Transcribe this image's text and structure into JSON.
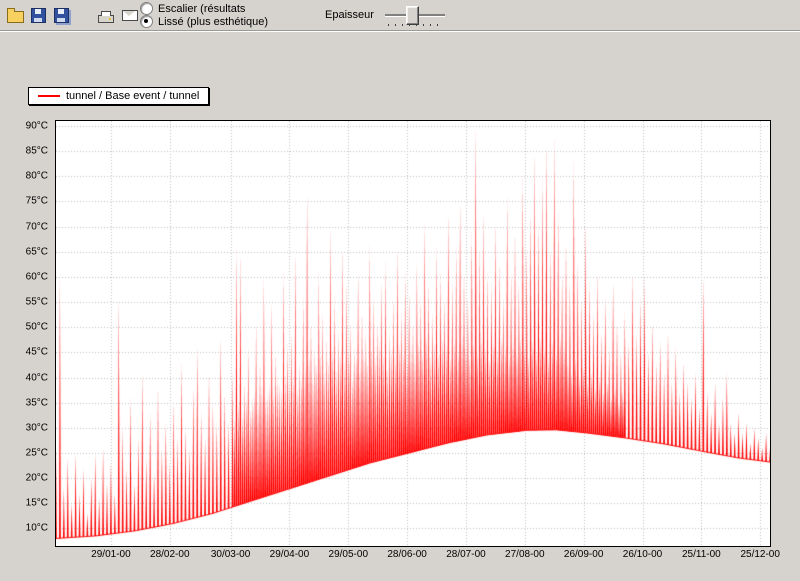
{
  "app": {
    "background": "#d6d3ce"
  },
  "toolbar": {
    "buttons": [
      {
        "icon": "open-folder-icon"
      },
      {
        "icon": "save-icon"
      },
      {
        "icon": "save-all-icon"
      },
      {
        "icon": "print-icon"
      },
      {
        "icon": "mail-icon"
      }
    ],
    "radio_options": [
      {
        "label": "Escalier (résultats",
        "selected": false
      },
      {
        "label": "Lissé (plus  esthétique)",
        "selected": true
      }
    ],
    "thickness_label": "Epaisseur",
    "thickness_percent": 35
  },
  "legend": {
    "entries": [
      {
        "label": "tunnel / Base event / tunnel",
        "color": "#ff0000"
      }
    ]
  },
  "chart_data": {
    "type": "line",
    "title": "",
    "xlabel": "",
    "ylabel": "",
    "series_name": "tunnel / Base event / tunnel",
    "series_color": "#ff0000",
    "grid": true,
    "grid_color": "#bfbfbf",
    "x_unit": "days since 01/01/00",
    "xlim": [
      0,
      364
    ],
    "ylim": [
      6.5,
      91
    ],
    "y_ticks": [
      {
        "v": 10,
        "label": "10°C"
      },
      {
        "v": 15,
        "label": "15°C"
      },
      {
        "v": 20,
        "label": "20°C"
      },
      {
        "v": 25,
        "label": "25°C"
      },
      {
        "v": 30,
        "label": "30°C"
      },
      {
        "v": 35,
        "label": "35°C"
      },
      {
        "v": 40,
        "label": "40°C"
      },
      {
        "v": 45,
        "label": "45°C"
      },
      {
        "v": 50,
        "label": "50°C"
      },
      {
        "v": 55,
        "label": "55°C"
      },
      {
        "v": 60,
        "label": "60°C"
      },
      {
        "v": 65,
        "label": "65°C"
      },
      {
        "v": 70,
        "label": "70°C"
      },
      {
        "v": 75,
        "label": "75°C"
      },
      {
        "v": 80,
        "label": "80°C"
      },
      {
        "v": 85,
        "label": "85°C"
      },
      {
        "v": 90,
        "label": "90°C"
      }
    ],
    "x_ticks": [
      {
        "day": 28,
        "label": "29/01-00"
      },
      {
        "day": 58,
        "label": "28/02-00"
      },
      {
        "day": 89,
        "label": "30/03-00"
      },
      {
        "day": 119,
        "label": "29/04-00"
      },
      {
        "day": 149,
        "label": "29/05-00"
      },
      {
        "day": 179,
        "label": "28/06-00"
      },
      {
        "day": 209,
        "label": "28/07-00"
      },
      {
        "day": 239,
        "label": "27/08-00"
      },
      {
        "day": 269,
        "label": "26/09-00"
      },
      {
        "day": 299,
        "label": "26/10-00"
      },
      {
        "day": 329,
        "label": "25/11-00"
      },
      {
        "day": 359,
        "label": "25/12-00"
      }
    ],
    "baseline_keypoints": [
      [
        0,
        8
      ],
      [
        20,
        8.5
      ],
      [
        40,
        9.5
      ],
      [
        60,
        11
      ],
      [
        80,
        13
      ],
      [
        100,
        15.5
      ],
      [
        120,
        18
      ],
      [
        140,
        20.5
      ],
      [
        160,
        23
      ],
      [
        180,
        25
      ],
      [
        200,
        27
      ],
      [
        220,
        28.6
      ],
      [
        240,
        29.5
      ],
      [
        255,
        29.6
      ],
      [
        270,
        29
      ],
      [
        290,
        28
      ],
      [
        310,
        26.8
      ],
      [
        330,
        25.3
      ],
      [
        348,
        24
      ],
      [
        364,
        23.2
      ]
    ],
    "spikes": [
      [
        0,
        26
      ],
      [
        2,
        60
      ],
      [
        4,
        18
      ],
      [
        6,
        24
      ],
      [
        8,
        15
      ],
      [
        10,
        25
      ],
      [
        12,
        17
      ],
      [
        14,
        22
      ],
      [
        16,
        13
      ],
      [
        18,
        20
      ],
      [
        20,
        25
      ],
      [
        22,
        16
      ],
      [
        24,
        26
      ],
      [
        26,
        19
      ],
      [
        28,
        23
      ],
      [
        30,
        17
      ],
      [
        32,
        56
      ],
      [
        34,
        30
      ],
      [
        36,
        22
      ],
      [
        38,
        36
      ],
      [
        40,
        19
      ],
      [
        42,
        28
      ],
      [
        44,
        41
      ],
      [
        46,
        24
      ],
      [
        48,
        33
      ],
      [
        50,
        21
      ],
      [
        52,
        38
      ],
      [
        54,
        26
      ],
      [
        56,
        31
      ],
      [
        58,
        23
      ],
      [
        60,
        35
      ],
      [
        62,
        28
      ],
      [
        64,
        43
      ],
      [
        66,
        30
      ],
      [
        68,
        26
      ],
      [
        70,
        38
      ],
      [
        72,
        46
      ],
      [
        74,
        33
      ],
      [
        76,
        28
      ],
      [
        78,
        41
      ],
      [
        80,
        35
      ],
      [
        82,
        31
      ],
      [
        84,
        48
      ],
      [
        86,
        37
      ],
      [
        88,
        31
      ],
      [
        90,
        41
      ],
      [
        92,
        66
      ],
      [
        94,
        65
      ],
      [
        96,
        39
      ],
      [
        98,
        46
      ],
      [
        100,
        36
      ],
      [
        102,
        51
      ],
      [
        104,
        43
      ],
      [
        106,
        60
      ],
      [
        108,
        37
      ],
      [
        110,
        55
      ],
      [
        112,
        45
      ],
      [
        114,
        39
      ],
      [
        116,
        61
      ],
      [
        118,
        47
      ],
      [
        120,
        49
      ],
      [
        122,
        65
      ],
      [
        124,
        43
      ],
      [
        126,
        56
      ],
      [
        128,
        77
      ],
      [
        130,
        51
      ],
      [
        132,
        46
      ],
      [
        134,
        61
      ],
      [
        136,
        53
      ],
      [
        138,
        48
      ],
      [
        140,
        70
      ],
      [
        142,
        56
      ],
      [
        144,
        49
      ],
      [
        146,
        66
      ],
      [
        148,
        59
      ],
      [
        150,
        51
      ],
      [
        152,
        46
      ],
      [
        154,
        61
      ],
      [
        156,
        53
      ],
      [
        158,
        49
      ],
      [
        160,
        66
      ],
      [
        162,
        56
      ],
      [
        164,
        51
      ],
      [
        166,
        59
      ],
      [
        168,
        63
      ],
      [
        170,
        49
      ],
      [
        172,
        56
      ],
      [
        174,
        66
      ],
      [
        176,
        53
      ],
      [
        178,
        61
      ],
      [
        180,
        57
      ],
      [
        182,
        51
      ],
      [
        184,
        63
      ],
      [
        186,
        56
      ],
      [
        188,
        71
      ],
      [
        190,
        59
      ],
      [
        192,
        53
      ],
      [
        194,
        66
      ],
      [
        196,
        61
      ],
      [
        198,
        56
      ],
      [
        200,
        73
      ],
      [
        202,
        59
      ],
      [
        204,
        66
      ],
      [
        206,
        75
      ],
      [
        208,
        61
      ],
      [
        210,
        56
      ],
      [
        212,
        69
      ],
      [
        214,
        90
      ],
      [
        216,
        66
      ],
      [
        218,
        73
      ],
      [
        220,
        61
      ],
      [
        222,
        59
      ],
      [
        224,
        71
      ],
      [
        226,
        63
      ],
      [
        228,
        56
      ],
      [
        230,
        76
      ],
      [
        232,
        61
      ],
      [
        234,
        69
      ],
      [
        236,
        59
      ],
      [
        238,
        80
      ],
      [
        240,
        66
      ],
      [
        242,
        73
      ],
      [
        244,
        85
      ],
      [
        246,
        71
      ],
      [
        248,
        80
      ],
      [
        250,
        87
      ],
      [
        252,
        66
      ],
      [
        254,
        88
      ],
      [
        256,
        73
      ],
      [
        258,
        61
      ],
      [
        260,
        67
      ],
      [
        262,
        59
      ],
      [
        264,
        83
      ],
      [
        266,
        63
      ],
      [
        268,
        56
      ],
      [
        270,
        71
      ],
      [
        272,
        59
      ],
      [
        274,
        53
      ],
      [
        276,
        61
      ],
      [
        278,
        49
      ],
      [
        280,
        56
      ],
      [
        282,
        46
      ],
      [
        284,
        59
      ],
      [
        286,
        51
      ],
      [
        288,
        45
      ],
      [
        290,
        53
      ],
      [
        292,
        47
      ],
      [
        294,
        61
      ],
      [
        296,
        49
      ],
      [
        298,
        56
      ],
      [
        300,
        60
      ],
      [
        302,
        45
      ],
      [
        304,
        51
      ],
      [
        306,
        43
      ],
      [
        308,
        47
      ],
      [
        310,
        41
      ],
      [
        312,
        49
      ],
      [
        314,
        39
      ],
      [
        316,
        46
      ],
      [
        318,
        37
      ],
      [
        320,
        43
      ],
      [
        322,
        39
      ],
      [
        324,
        36
      ],
      [
        326,
        41
      ],
      [
        328,
        34
      ],
      [
        330,
        60
      ],
      [
        332,
        37
      ],
      [
        334,
        33
      ],
      [
        336,
        39
      ],
      [
        338,
        31
      ],
      [
        340,
        36
      ],
      [
        342,
        41
      ],
      [
        344,
        31
      ],
      [
        346,
        29
      ],
      [
        348,
        33
      ],
      [
        350,
        29
      ],
      [
        352,
        31
      ],
      [
        354,
        27
      ],
      [
        356,
        30
      ],
      [
        358,
        28
      ],
      [
        360,
        26
      ],
      [
        362,
        29
      ],
      [
        364,
        26
      ],
      [
        91,
        32
      ],
      [
        93,
        35
      ],
      [
        95,
        33
      ],
      [
        97,
        36
      ],
      [
        99,
        34
      ],
      [
        101,
        37
      ],
      [
        103,
        35
      ],
      [
        105,
        38
      ],
      [
        107,
        36
      ],
      [
        109,
        39
      ],
      [
        111,
        37
      ],
      [
        113,
        40
      ],
      [
        115,
        38
      ],
      [
        117,
        41
      ],
      [
        119,
        39
      ],
      [
        121,
        40
      ],
      [
        123,
        38
      ],
      [
        125,
        40
      ],
      [
        127,
        42
      ],
      [
        129,
        44
      ],
      [
        131,
        40
      ],
      [
        133,
        43
      ],
      [
        135,
        45
      ],
      [
        137,
        41
      ],
      [
        139,
        44
      ],
      [
        141,
        46
      ],
      [
        143,
        42
      ],
      [
        145,
        45
      ],
      [
        147,
        43
      ],
      [
        149,
        46
      ],
      [
        151,
        40
      ],
      [
        153,
        44
      ],
      [
        155,
        42
      ],
      [
        157,
        45
      ],
      [
        159,
        43
      ],
      [
        161,
        46
      ],
      [
        163,
        44
      ],
      [
        165,
        47
      ],
      [
        167,
        45
      ],
      [
        169,
        42
      ],
      [
        171,
        46
      ],
      [
        173,
        44
      ],
      [
        175,
        47
      ],
      [
        177,
        45
      ],
      [
        179,
        43
      ],
      [
        181,
        46
      ],
      [
        183,
        44
      ],
      [
        185,
        47
      ],
      [
        187,
        45
      ],
      [
        189,
        48
      ],
      [
        191,
        44
      ],
      [
        193,
        47
      ],
      [
        195,
        45
      ],
      [
        197,
        48
      ],
      [
        199,
        46
      ],
      [
        201,
        44
      ],
      [
        203,
        47
      ],
      [
        205,
        45
      ],
      [
        207,
        48
      ],
      [
        209,
        46
      ],
      [
        211,
        44
      ],
      [
        213,
        47
      ],
      [
        215,
        45
      ],
      [
        217,
        48
      ],
      [
        219,
        46
      ],
      [
        221,
        44
      ],
      [
        223,
        47
      ],
      [
        225,
        45
      ],
      [
        227,
        48
      ],
      [
        229,
        46
      ],
      [
        231,
        44
      ],
      [
        233,
        47
      ],
      [
        235,
        45
      ],
      [
        237,
        48
      ],
      [
        239,
        46
      ],
      [
        241,
        44
      ],
      [
        243,
        47
      ],
      [
        245,
        45
      ],
      [
        247,
        48
      ],
      [
        249,
        46
      ],
      [
        251,
        44
      ],
      [
        253,
        47
      ],
      [
        255,
        45
      ],
      [
        257,
        48
      ],
      [
        259,
        46
      ],
      [
        261,
        43
      ],
      [
        263,
        41
      ],
      [
        265,
        44
      ],
      [
        267,
        40
      ],
      [
        269,
        42
      ],
      [
        271,
        39
      ],
      [
        273,
        41
      ],
      [
        275,
        38
      ],
      [
        277,
        40
      ],
      [
        279,
        37
      ],
      [
        281,
        39
      ],
      [
        283,
        36
      ],
      [
        285,
        38
      ],
      [
        287,
        35
      ],
      [
        289,
        37
      ]
    ]
  }
}
